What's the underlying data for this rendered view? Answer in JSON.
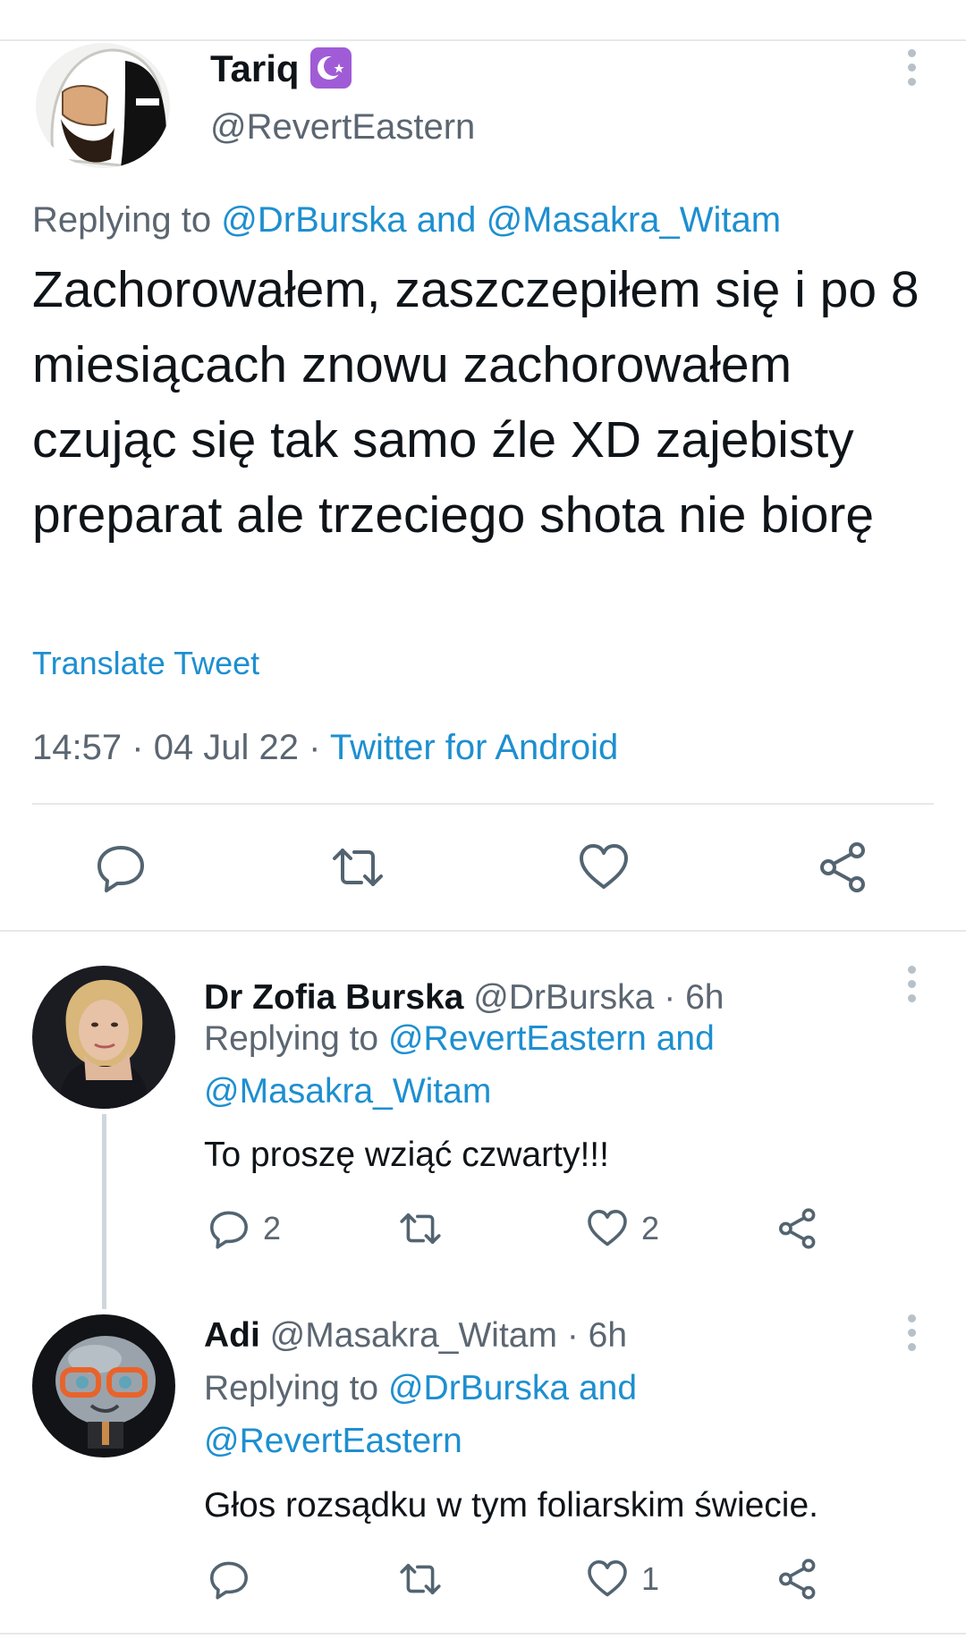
{
  "main_tweet": {
    "name": "Tariq",
    "handle": "@RevertEastern",
    "replying_prefix": "Replying to",
    "replying_user1": "@DrBurska",
    "replying_and": "and",
    "replying_user2": "@Masakra_Witam",
    "text": "Zachorowałem, zaszczepiłem się i po 8 miesiącach znowu zachorowałem czując się tak samo źle XD zajebisty preparat ale trzeciego shota nie biorę",
    "translate": "Translate Tweet",
    "time": "14:57",
    "date": "04 Jul 22",
    "sep": "·",
    "source": "Twitter for Android"
  },
  "replies": [
    {
      "name": "Dr Zofia Burska",
      "handle": "@DrBurska",
      "age": "6h",
      "replying_prefix": "Replying to",
      "replying_user1": "@RevertEastern",
      "replying_and": "and",
      "replying_user2": "@Masakra_Witam",
      "text": "To proszę wziąć czwarty!!!",
      "reply_count": "2",
      "retweet_count": "",
      "like_count": "2"
    },
    {
      "name": "Adi",
      "handle": "@Masakra_Witam",
      "age": "6h",
      "replying_prefix": "Replying to",
      "replying_user1": "@DrBurska",
      "replying_and": "and",
      "replying_user2": "@RevertEastern",
      "text": "Głos rozsądku w tym foliarskim świecie.",
      "reply_count": "",
      "retweet_count": "",
      "like_count": "1"
    }
  ],
  "colors": {
    "link": "#1d8fd0",
    "secondary": "#5b6671",
    "badge": "#a05cd6"
  },
  "icons": [
    "reply-icon",
    "retweet-icon",
    "like-icon",
    "share-icon",
    "more-icon",
    "crescent-star-badge-icon"
  ]
}
